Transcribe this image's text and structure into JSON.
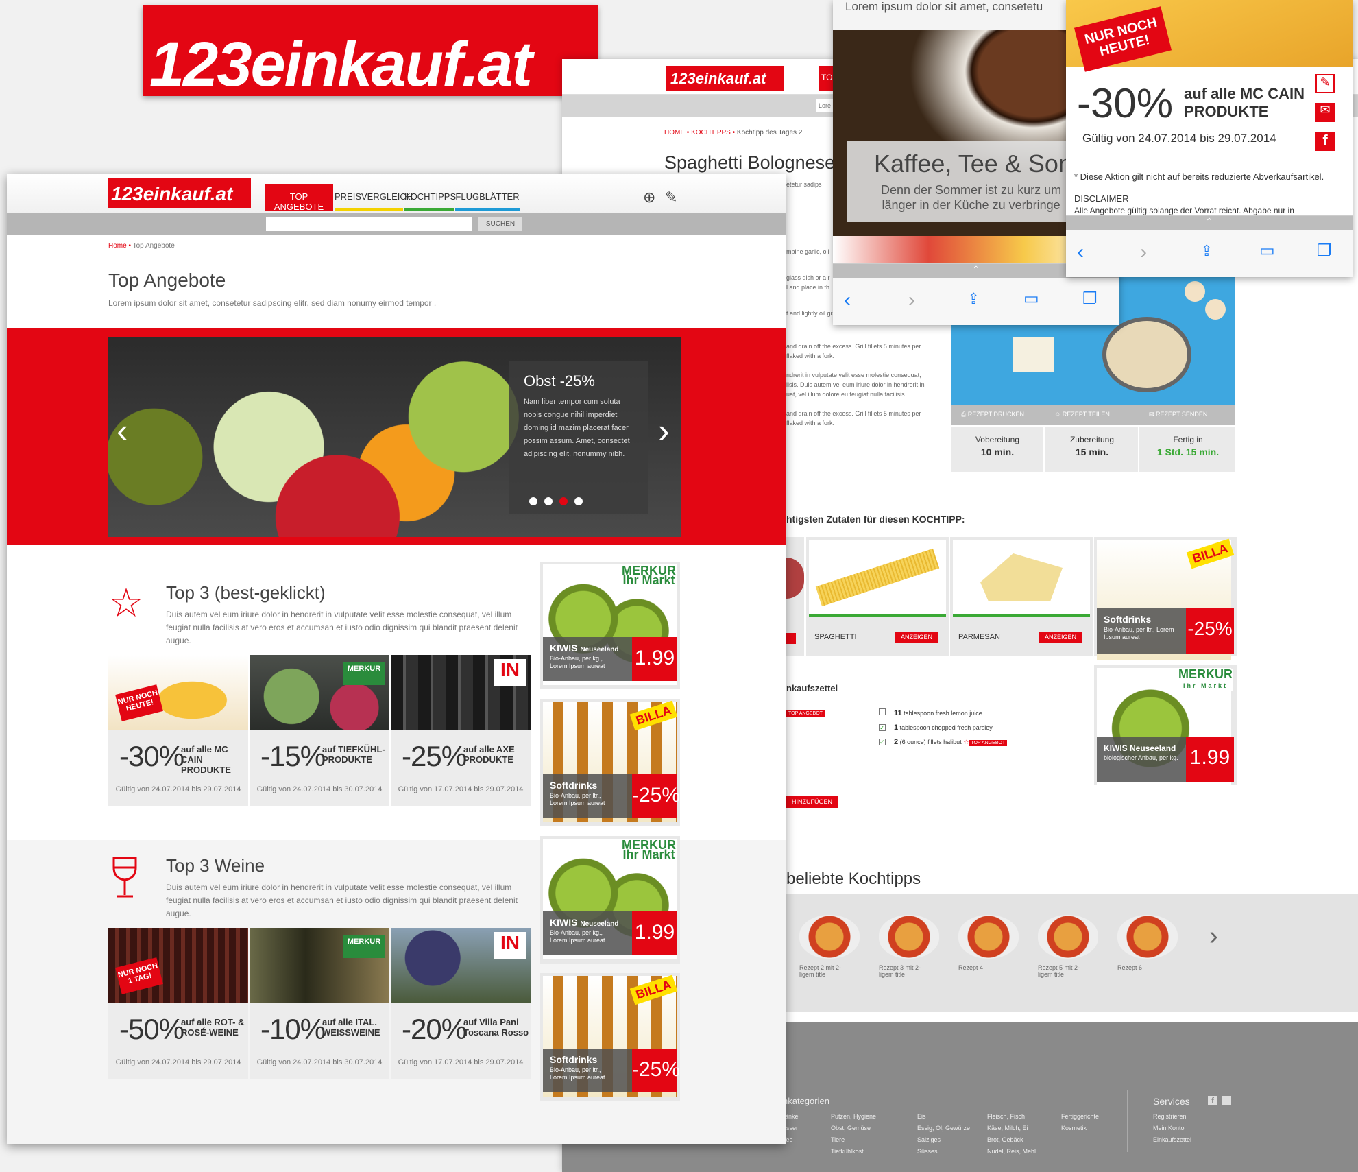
{
  "logo": "123einkauf.at",
  "back_page": {
    "logo": "123einkauf.at",
    "nav_partial": "TO",
    "search_placeholder": "Lore",
    "breadcrumb": [
      "HOME",
      "KOCHTIPPS",
      "Kochtipp des Tages 2"
    ],
    "title": "Spaghetti Bolognese",
    "intro_partial": "etetur sadips",
    "steps": [
      "mbine garlic, oli",
      "glass dish or a r",
      "l and place in th",
      "t and lightly oil grate. Set grate 4 inches from the",
      "and drain off the excess. Grill fillets 5 minutes per",
      "flaked with a fork.",
      "ndrerit in vulputate velit esse molestie consequat,",
      "lisis. Duis autem vel eum iriure dolor in hendrerit in",
      "uat, vel illum dolore eu feugiat nulla facilisis.",
      "and drain off the excess. Grill fillets 5 minutes per",
      "flaked with a fork."
    ],
    "recipe_actions": [
      "REZEPT DRUCKEN",
      "REZEPT TEILEN",
      "REZEPT SENDEN"
    ],
    "times": [
      {
        "label": "Vobereitung",
        "value": "10 min."
      },
      {
        "label": "Zubereitung",
        "value": "15 min."
      },
      {
        "label": "Fertig in",
        "value": "1 Std. 15 min."
      }
    ],
    "ingredients_heading": "htigsten Zutaten für diesen KOCHTIPP:",
    "ingredients": [
      {
        "name": "SPAGHETTI",
        "button": "ANZEIGEN"
      },
      {
        "name": "PARMESAN",
        "button": "ANZEIGEN"
      }
    ],
    "softdrinks": {
      "title": "Softdrinks",
      "sub": "Bio-Anbau, per ltr., Lorem Ipsum aureat",
      "price": "-25%"
    },
    "kiwis": {
      "title": "KIWIS Neuseeland",
      "sub": "biologischer Anbau, per kg.",
      "price": "1.99"
    },
    "shopping_heading": "nkaufszettel",
    "shopping_items": [
      {
        "qty": "11",
        "text": "tablespoon fresh lemon juice",
        "checked": false
      },
      {
        "qty": "1",
        "text": "tablespoon chopped fresh parsley",
        "checked": true
      },
      {
        "qty": "2",
        "text": "(6 ounce) fillets halibut",
        "checked": true
      }
    ],
    "top_angebot_tag": "TOP ANGEBOT",
    "add_button": "HINZUFÜGEN",
    "popular_heading": "beliebte Kochtipps",
    "recipes": [
      {
        "title": "Rezept 2 mit 2-\nligem title"
      },
      {
        "title": "Rezept 3 mit 2-\nligem title"
      },
      {
        "title": "Rezept 4"
      },
      {
        "title": "Rezept 5 mit 2-\nligem title"
      },
      {
        "title": "Rezept 6"
      }
    ],
    "footer": {
      "categories_heading": "nkategorien",
      "col0": "ränke\nasser\nTee",
      "col1": "Putzen, Hygiene\nObst, Gemüse\nTiere\nTiefkühlkost",
      "col2": "Eis\nEssig, Öl, Gewürze\nSalziges\nSüsses",
      "col3": "Fleisch, Fisch\nKäse, Milch, Ei\nBrot, Gebäck\nNudel, Reis, Mehl",
      "col4": "Fertiggerichte\nKosmetik",
      "services_heading": "Services",
      "services": "Registrieren\nMein Konto\nEinkaufszettel"
    }
  },
  "tablet1": {
    "top_text": "Lorem ipsum dolor sit amet, consetetu",
    "banner_title": "Kaffee, Tee & Sonn",
    "banner_text": "Denn der Sommer ist zu kurz um\nlänger in der Küche zu verbringe"
  },
  "tablet2": {
    "badge": "NUR NOCH\nHEUTE!",
    "pct": "-30%",
    "desc": "auf alle MC CAIN\nPRODUKTE",
    "valid": "Gültig von 24.07.2014 bis 29.07.2014",
    "note": "* Diese Aktion gilt nicht auf bereits reduzierte Abverkaufsartikel.",
    "disclaimer": "DISCLAIMER",
    "disclaimer_text": "Alle Angebote gültig solange der Vorrat reicht. Abgabe nur in"
  },
  "front": {
    "logo": "123einkauf.at",
    "nav": [
      "TOP ANGEBOTE",
      "PREISVERGLEICH",
      "KOCHTIPPS",
      "FLUGBLÄTTER"
    ],
    "search_button": "SUCHEN",
    "breadcrumb": [
      "Home",
      "Top Angebote"
    ],
    "title": "Top Angebote",
    "subtitle": "Lorem ipsum dolor sit amet, consetetur sadipscing elitr, sed diam nonumy eirmod tempor .",
    "slider": {
      "title": "Obst -25%",
      "text": "Nam liber tempor cum soluta nobis congue nihil imperdiet doming id mazim placerat facer possim assum. Amet, consectet adipiscing elit, nonummy nibh."
    },
    "top3": {
      "title": "Top 3 (best-geklickt)",
      "text": "Duis autem vel eum iriure dolor in hendrerit in vulputate velit esse molestie consequat, vel illum feugiat nulla facilisis at vero eros et accumsan et iusto odio dignissim qui blandit praesent delenit augue.",
      "cards": [
        {
          "badge": "NUR NOCH\nHEUTE!",
          "pct": "-30%",
          "desc": "auf alle MC CAIN\nPRODUKTE",
          "valid": "Gültig von 24.07.2014 bis 29.07.2014"
        },
        {
          "badge": "MERKUR",
          "pct": "-15%",
          "desc": "auf TIEFKÜHL-\nPRODUKTE",
          "valid": "Gültig von 24.07.2014 bis 30.07.2014"
        },
        {
          "badge": "IN",
          "pct": "-25%",
          "desc": "auf alle AXE\nPRODUKTE",
          "valid": "Gültig von 17.07.2014 bis 29.07.2014"
        }
      ]
    },
    "weine": {
      "title": "Top 3 Weine",
      "text": "Duis autem vel eum iriure dolor in hendrerit in vulputate velit esse molestie consequat, vel illum feugiat nulla facilisis at vero eros et accumsan et iusto odio dignissim qui blandit praesent delenit augue.",
      "cards": [
        {
          "badge": "NUR NOCH\n1 TAG!",
          "pct": "-50%",
          "desc": "auf alle ROT- &\nROSÉ-WEINE",
          "valid": "Gültig von 24.07.2014 bis 29.07.2014"
        },
        {
          "badge": "MERKUR",
          "pct": "-10%",
          "desc": "auf alle ITAL.\nWEISSWEINE",
          "valid": "Gültig von 24.07.2014 bis 30.07.2014"
        },
        {
          "badge": "IN",
          "pct": "-20%",
          "desc": "auf Villa Pani\nToscana Rosso",
          "valid": "Gültig von 17.07.2014 bis 29.07.2014"
        }
      ]
    },
    "side": [
      {
        "store": "MERKUR\nIhr Markt",
        "title": "KIWIS",
        "title_suffix": "Neuseeland",
        "sub": "Bio-Anbau, per kg.,\nLorem Ipsum aureat",
        "price": "1.99"
      },
      {
        "store": "BILLA",
        "title": "Softdrinks",
        "title_suffix": "",
        "sub": "Bio-Anbau, per ltr.,\nLorem Ipsum aureat",
        "price": "-25%"
      },
      {
        "store": "MERKUR\nIhr Markt",
        "title": "KIWIS",
        "title_suffix": "Neuseeland",
        "sub": "Bio-Anbau, per kg.,\nLorem Ipsum aureat",
        "price": "1.99"
      },
      {
        "store": "BILLA",
        "title": "Softdrinks",
        "title_suffix": "",
        "sub": "Bio-Anbau, per ltr.,\nLorem Ipsum aureat",
        "price": "-25%"
      }
    ],
    "colors": {
      "brand_red": "#e30613",
      "nav_yellow": "#f4d200",
      "nav_green": "#3aa935",
      "nav_blue": "#1e9ad6",
      "grey_bar": "#b5b5b5"
    }
  }
}
